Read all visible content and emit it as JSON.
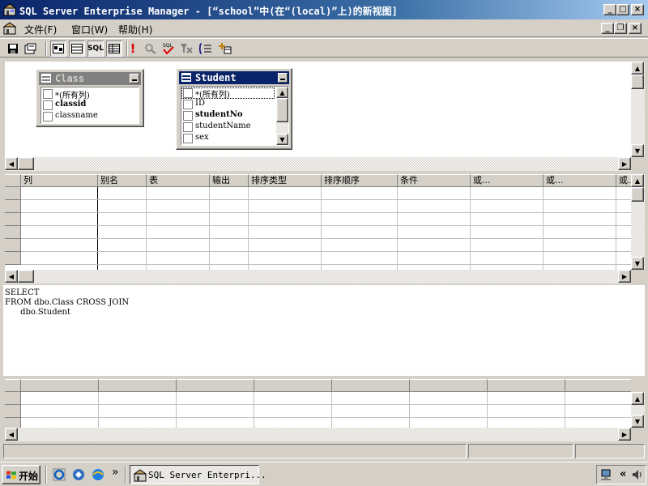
{
  "window": {
    "title": "SQL Server Enterprise Manager - [“school”中(在“(local)”上)的新视图]",
    "caption_buttons": {
      "minimize": "_",
      "maximize": "□",
      "close": "×"
    },
    "mdi_buttons": {
      "minimize": "_",
      "restore": "❐",
      "close": "×"
    }
  },
  "menu": [
    {
      "label": "文件(F)"
    },
    {
      "label": "窗口(W)"
    },
    {
      "label": "帮助(H)"
    }
  ],
  "toolbar": {
    "sql_label": "SQL",
    "run_label": "!"
  },
  "diagram": {
    "tables": [
      {
        "name": "Class",
        "active": false,
        "columns": [
          "*(所有列)",
          "classid",
          "classname"
        ],
        "bold": [
          false,
          true,
          false
        ]
      },
      {
        "name": "Student",
        "active": true,
        "columns": [
          "*(所有列)",
          "ID",
          "studentNo",
          "studentName",
          "sex"
        ],
        "bold": [
          false,
          false,
          true,
          false,
          false
        ]
      }
    ]
  },
  "grid": {
    "headers": [
      "列",
      "别名",
      "表",
      "输出",
      "排序类型",
      "排序顺序",
      "条件",
      "或...",
      "或...",
      "或..."
    ]
  },
  "sql": {
    "text": "SELECT\nFROM dbo.Class CROSS JOIN\n      dbo.Student"
  },
  "taskbar": {
    "start_label": "开始",
    "task_label": "SQL Server Enterpri...",
    "chevron": "»",
    "tray_chevron": "«"
  },
  "colors": {
    "active_title": "#0a246a",
    "inactive_title": "#808080",
    "face": "#d4d0c8"
  },
  "icons": [
    "app-icon",
    "save-icon",
    "properties-icon",
    "diagram-pane-icon",
    "grid-pane-icon",
    "sql-pane-icon",
    "results-pane-icon",
    "run-icon",
    "verify-sql-icon",
    "remove-filter-icon",
    "group-by-icon",
    "add-table-icon",
    "windows-flag-icon",
    "ie-icon",
    "outlook-icon",
    "desktop-icon"
  ]
}
